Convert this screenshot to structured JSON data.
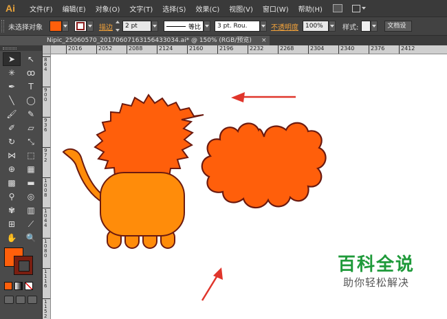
{
  "app": {
    "logo": "Ai"
  },
  "menu": [
    {
      "label": "文件(F)"
    },
    {
      "label": "编辑(E)"
    },
    {
      "label": "对象(O)"
    },
    {
      "label": "文字(T)"
    },
    {
      "label": "选择(S)"
    },
    {
      "label": "效果(C)"
    },
    {
      "label": "视图(V)"
    },
    {
      "label": "窗口(W)"
    },
    {
      "label": "帮助(H)"
    }
  ],
  "control": {
    "selection_status": "未选择对象",
    "fill_color": "#ff5f0b",
    "stroke_label": "描边",
    "stroke_weight": "2 pt",
    "stroke_profile": "等比",
    "brush": "3 pt. Rou.",
    "opacity_label": "不透明度",
    "opacity_value": "100%",
    "style_label": "样式:",
    "doc_setup": "文档设"
  },
  "document": {
    "tab_title": "Nipic_25060570_20170607163156433034.ai* @ 150% (RGB/预览)",
    "close_glyph": "×"
  },
  "ruler": {
    "top": [
      "2016",
      "2052",
      "2088",
      "2124",
      "2160",
      "2196",
      "2232",
      "2268",
      "2304",
      "2340",
      "2376",
      "2412"
    ],
    "left": [
      "864",
      "900",
      "936",
      "972",
      "1008",
      "1044",
      "1080",
      "1116",
      "1152"
    ]
  },
  "toolbox": {
    "fill_color": "#ff5f0b",
    "stroke_color": "#7a1e10",
    "tools": [
      {
        "name": "selection-tool-icon",
        "glyph": "➤",
        "active": true
      },
      {
        "name": "direct-selection-tool-icon",
        "glyph": "↖"
      },
      {
        "name": "magic-wand-tool-icon",
        "glyph": "✳"
      },
      {
        "name": "lasso-tool-icon",
        "glyph": "ꝏ"
      },
      {
        "name": "pen-tool-icon",
        "glyph": "✒"
      },
      {
        "name": "type-tool-icon",
        "glyph": "T"
      },
      {
        "name": "line-tool-icon",
        "glyph": "╲"
      },
      {
        "name": "ellipse-tool-icon",
        "glyph": "◯"
      },
      {
        "name": "paintbrush-tool-icon",
        "glyph": "🖌"
      },
      {
        "name": "pencil-tool-icon",
        "glyph": "✎"
      },
      {
        "name": "blob-brush-tool-icon",
        "glyph": "✐"
      },
      {
        "name": "eraser-tool-icon",
        "glyph": "▱"
      },
      {
        "name": "rotate-tool-icon",
        "glyph": "↻"
      },
      {
        "name": "scale-tool-icon",
        "glyph": "⤡"
      },
      {
        "name": "width-tool-icon",
        "glyph": "⋈"
      },
      {
        "name": "free-transform-tool-icon",
        "glyph": "⬚"
      },
      {
        "name": "shape-builder-tool-icon",
        "glyph": "⊕"
      },
      {
        "name": "perspective-grid-tool-icon",
        "glyph": "▦"
      },
      {
        "name": "mesh-tool-icon",
        "glyph": "▩"
      },
      {
        "name": "gradient-tool-icon",
        "glyph": "▬"
      },
      {
        "name": "eyedropper-tool-icon",
        "glyph": "⚲"
      },
      {
        "name": "blend-tool-icon",
        "glyph": "◎"
      },
      {
        "name": "symbol-sprayer-tool-icon",
        "glyph": "✾"
      },
      {
        "name": "column-graph-tool-icon",
        "glyph": "▥"
      },
      {
        "name": "artboard-tool-icon",
        "glyph": "⊞"
      },
      {
        "name": "slice-tool-icon",
        "glyph": "⟋"
      },
      {
        "name": "hand-tool-icon",
        "glyph": "✋"
      },
      {
        "name": "zoom-tool-icon",
        "glyph": "🔍"
      }
    ]
  },
  "watermark": {
    "title": "百科全说",
    "subtitle": "助你轻松解决"
  }
}
